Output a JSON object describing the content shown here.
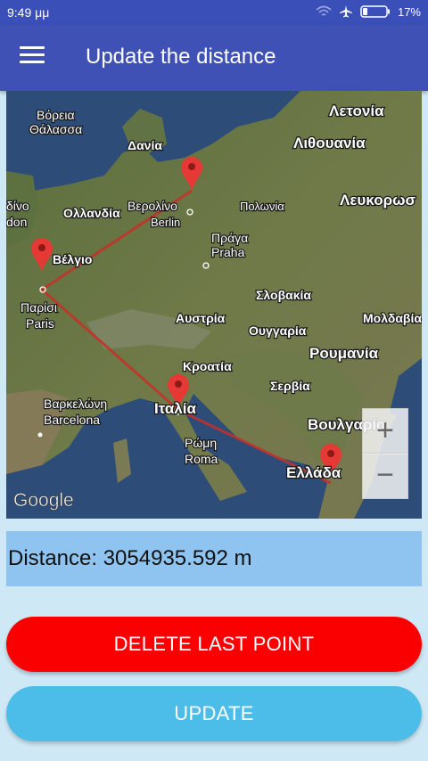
{
  "status": {
    "time": "9:49 μμ",
    "battery": "17%"
  },
  "appbar": {
    "title": "Update the distance",
    "menu_icon": "hamburger-menu-icon"
  },
  "map": {
    "attribution": "Google",
    "labels": {
      "north_sea_1": "Βόρεια",
      "north_sea_2": "Θάλασσα",
      "denmark": "Δανία",
      "latvia": "Λετονία",
      "lithuania": "Λιθουανία",
      "netherlands": "Ολλανδία",
      "berlin_gr": "Βερολίνο",
      "berlin": "Berlin",
      "poland": "Πολωνία",
      "belarus": "Λευκορωσ",
      "london_1": "δίνο",
      "london_2": "don",
      "belgium": "Βέλγιο",
      "prague_gr": "Πράγα",
      "prague": "Praha",
      "paris_gr": "Παρίσι",
      "paris": "Paris",
      "slovakia": "Σλοβακία",
      "austria": "Αυστρία",
      "hungary": "Ουγγαρία",
      "moldova": "Μολδαβία",
      "romania": "Ρουμανία",
      "croatia": "Κροατία",
      "serbia": "Σερβία",
      "barcelona_gr": "Βαρκελώνη",
      "barcelona": "Barcelona",
      "italy": "Ιταλία",
      "bulgaria": "Βουλγαρία",
      "rome_gr": "Ρώμη",
      "rome": "Roma",
      "greece": "Ελλάδα"
    },
    "zoom_in": "+",
    "zoom_out": "−"
  },
  "distance": {
    "text": "Distance: 3054935.592 m"
  },
  "buttons": {
    "delete": "DELETE LAST POINT",
    "update": "UPDATE"
  }
}
